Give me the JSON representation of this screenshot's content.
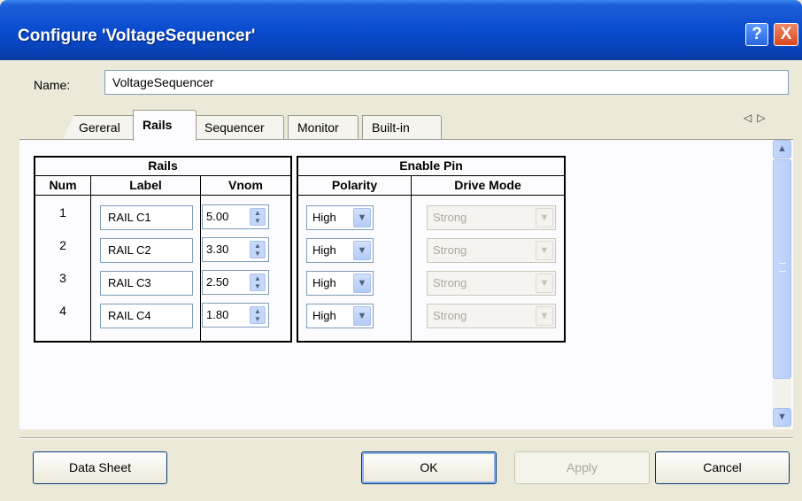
{
  "window": {
    "title": "Configure 'VoltageSequencer'",
    "help_glyph": "?",
    "close_glyph": "X"
  },
  "name_field": {
    "label": "Name:",
    "value": "VoltageSequencer"
  },
  "tabs": [
    {
      "label": "Gereral",
      "active": false
    },
    {
      "label": "Rails",
      "active": true
    },
    {
      "label": "Sequencer",
      "active": false
    },
    {
      "label": "Monitor",
      "active": false
    },
    {
      "label": "Built-in",
      "active": false
    }
  ],
  "tab_scroll": {
    "left": "◁",
    "right": "▷"
  },
  "rails_table": {
    "group_header": "Rails",
    "columns": [
      "Num",
      "Label",
      "Vnom"
    ]
  },
  "enable_table": {
    "group_header": "Enable Pin",
    "columns": [
      "Polarity",
      "Drive Mode"
    ]
  },
  "rows": [
    {
      "num": "1",
      "label": "RAIL C1",
      "vnom": "5.00",
      "polarity": "High",
      "drive_mode": "Strong"
    },
    {
      "num": "2",
      "label": "RAIL C2",
      "vnom": "3.30",
      "polarity": "High",
      "drive_mode": "Strong"
    },
    {
      "num": "3",
      "label": "RAIL C3",
      "vnom": "2.50",
      "polarity": "High",
      "drive_mode": "Strong"
    },
    {
      "num": "4",
      "label": "RAIL C4",
      "vnom": "1.80",
      "polarity": "High",
      "drive_mode": "Strong"
    }
  ],
  "buttons": {
    "datasheet": "Data Sheet",
    "ok": "OK",
    "apply": "Apply",
    "cancel": "Cancel"
  },
  "icons": {
    "spinner": "up-down-arrows-icon",
    "dropdown": "chevron-down-icon"
  }
}
